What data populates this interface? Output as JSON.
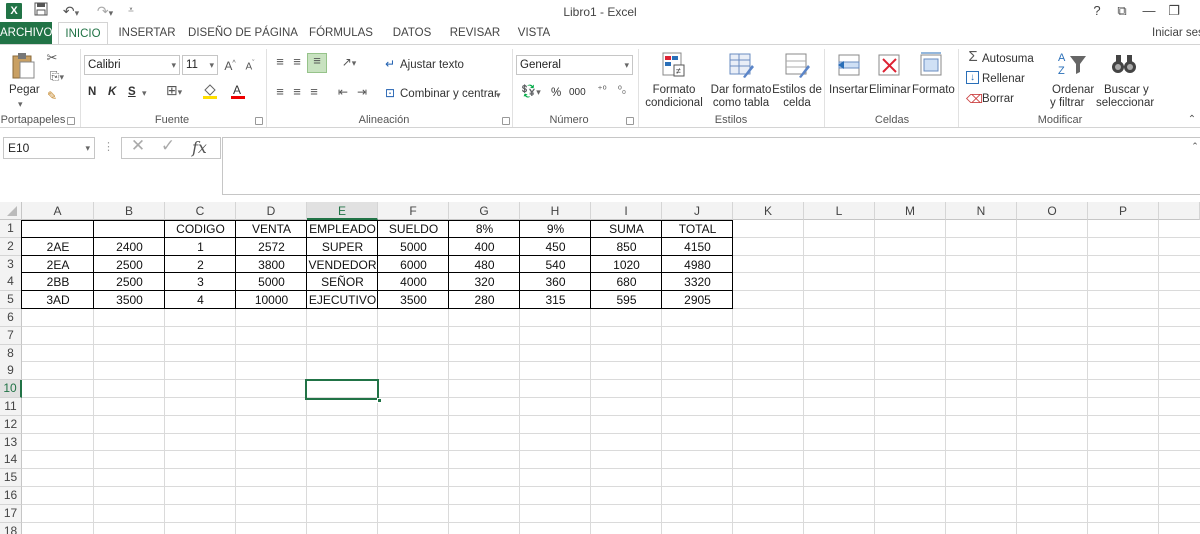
{
  "app": {
    "title": "Libro1 - Excel",
    "logo": "X"
  },
  "qat": {
    "save_icon": "save-icon",
    "undo_icon": "undo-icon",
    "redo_icon": "redo-icon",
    "customize_icon": "customize-icon"
  },
  "window": {
    "help": "?",
    "restore_ribbon": "⧉",
    "minimize": "—",
    "maximize": "❐"
  },
  "tabs": [
    "ARCHIVO",
    "INICIO",
    "INSERTAR",
    "DISEÑO DE PÁGINA",
    "FÓRMULAS",
    "DATOS",
    "REVISAR",
    "VISTA"
  ],
  "signin": "Iniciar sesi",
  "ribbon": {
    "clipboard": {
      "label": "Portapapeles",
      "paste": "Pegar"
    },
    "font": {
      "label": "Fuente",
      "family": "Calibri",
      "size": "11",
      "bold": "N",
      "italic": "K",
      "underline": "S"
    },
    "alignment": {
      "label": "Alineación",
      "wrap": "Ajustar texto",
      "merge": "Combinar y centrar"
    },
    "number": {
      "label": "Número",
      "format": "General",
      "percent": "%",
      "thousands": "000"
    },
    "styles": {
      "label": "Estilos",
      "cond1": "Formato",
      "cond2": "condicional",
      "table1": "Dar formato",
      "table2": "como tabla",
      "cell1": "Estilos de",
      "cell2": "celda"
    },
    "cells": {
      "label": "Celdas",
      "insert": "Insertar",
      "delete": "Eliminar",
      "format": "Formato"
    },
    "editing": {
      "label": "Modificar",
      "autosum": "Autosuma",
      "fill": "Rellenar",
      "clear": "Borrar",
      "sort1": "Ordenar",
      "sort2": "y filtrar",
      "find1": "Buscar y",
      "find2": "seleccionar"
    }
  },
  "formula_bar": {
    "name_box": "E10",
    "fx": "fx",
    "value": ""
  },
  "columns": [
    "A",
    "B",
    "C",
    "D",
    "E",
    "F",
    "G",
    "H",
    "I",
    "J",
    "K",
    "L",
    "M",
    "N",
    "O",
    "P"
  ],
  "rows": [
    "1",
    "2",
    "3",
    "4",
    "5",
    "6",
    "7",
    "8",
    "9",
    "10",
    "11",
    "12",
    "13",
    "14",
    "15",
    "16",
    "17",
    "18"
  ],
  "selected_cell": "E10",
  "table": [
    [
      "",
      "",
      "CODIGO",
      "VENTA",
      "EMPLEADO",
      "SUELDO",
      "8%",
      "9%",
      "SUMA",
      "TOTAL"
    ],
    [
      "2AE",
      "2400",
      "1",
      "2572",
      "SUPER",
      "5000",
      "400",
      "450",
      "850",
      "4150"
    ],
    [
      "2EA",
      "2500",
      "2",
      "3800",
      "VENDEDOR",
      "6000",
      "480",
      "540",
      "1020",
      "4980"
    ],
    [
      "2BB",
      "2500",
      "3",
      "5000",
      "SEÑOR",
      "4000",
      "320",
      "360",
      "680",
      "3320"
    ],
    [
      "3AD",
      "3500",
      "4",
      "10000",
      "EJECUTIVO",
      "3500",
      "280",
      "315",
      "595",
      "2905"
    ]
  ],
  "colors": {
    "accent": "#217346"
  }
}
